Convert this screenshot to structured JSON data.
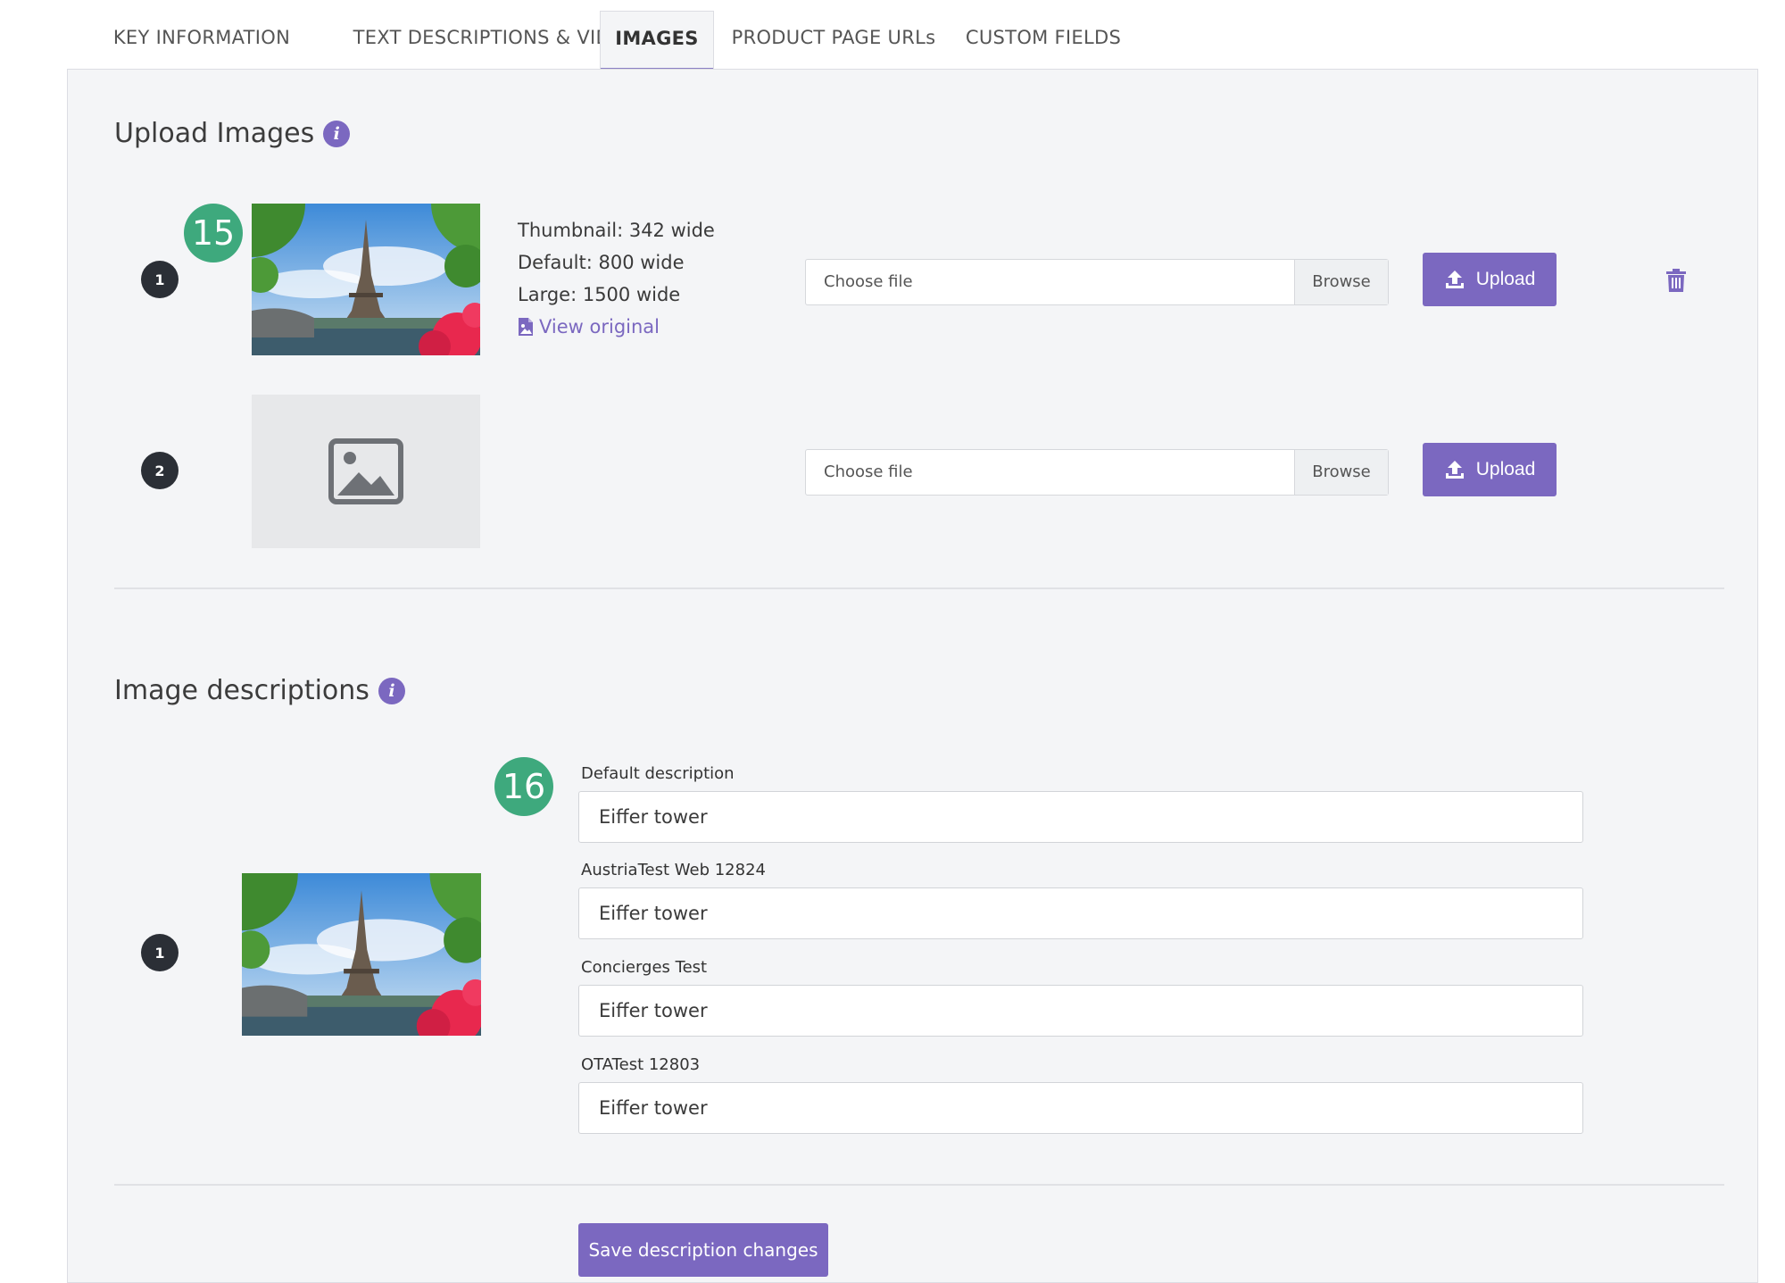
{
  "tabs": [
    {
      "label": "KEY INFORMATION"
    },
    {
      "label": "TEXT DESCRIPTIONS & VIDEO"
    },
    {
      "label": "IMAGES"
    },
    {
      "label": "PRODUCT PAGE URLs"
    },
    {
      "label": "CUSTOM FIELDS"
    }
  ],
  "active_tab": "IMAGES",
  "upload": {
    "title": "Upload Images",
    "rows": [
      {
        "number": "1",
        "badge": "15",
        "thumbnail_text": "Thumbnail: 342 wide",
        "default_text": "Default: 800 wide",
        "large_text": "Large: 1500 wide",
        "view_original": "View original",
        "file_placeholder": "Choose file",
        "browse_label": "Browse",
        "upload_label": "Upload"
      },
      {
        "number": "2",
        "file_placeholder": "Choose file",
        "browse_label": "Browse",
        "upload_label": "Upload"
      }
    ]
  },
  "descriptions": {
    "title": "Image descriptions",
    "row_number": "1",
    "badge": "16",
    "fields": [
      {
        "label": "Default description",
        "value": "Eiffer tower"
      },
      {
        "label": "AustriaTest Web 12824",
        "value": "Eiffer tower"
      },
      {
        "label": "Concierges Test",
        "value": "Eiffer tower"
      },
      {
        "label": "OTATest 12803",
        "value": "Eiffer tower"
      }
    ],
    "save_label": "Save description changes"
  },
  "colors": {
    "accent": "#7b68c0",
    "badge_green": "#3ea97d",
    "row_number_dark": "#2b2f36"
  }
}
